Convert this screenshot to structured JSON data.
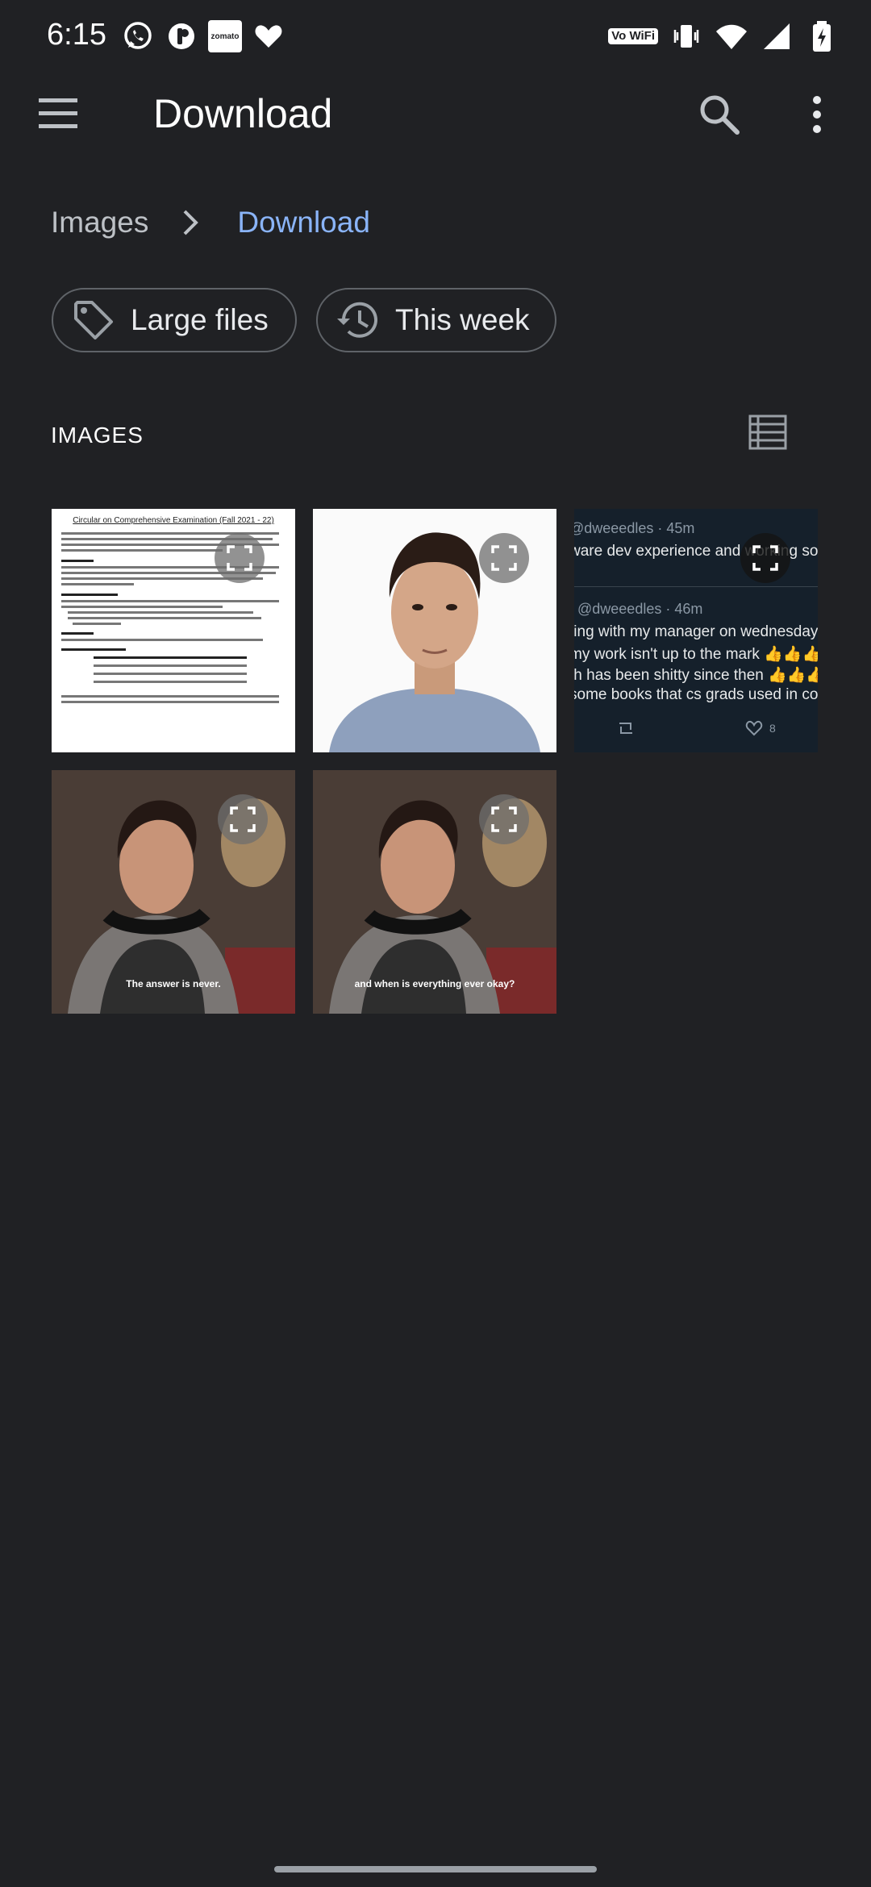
{
  "status_bar": {
    "time": "6:15",
    "left_icons": [
      "whatsapp-icon",
      "pocket-icon",
      "zomato-icon",
      "heart-icon"
    ],
    "zomato_text": "zomato",
    "wifi_calling": "Vo WiFi",
    "right_icons": [
      "vowifi-icon",
      "vibrate-icon",
      "wifi-icon",
      "signal-icon",
      "battery-charging-icon"
    ]
  },
  "app_bar": {
    "title": "Download",
    "menu_icon": "menu-icon",
    "search_icon": "search-icon",
    "more_icon": "more-vert-icon"
  },
  "breadcrumb": {
    "items": [
      "Images",
      "Download"
    ]
  },
  "chips": [
    {
      "label": "Large files",
      "icon": "tag-icon"
    },
    {
      "label": "This week",
      "icon": "history-icon"
    }
  ],
  "section": {
    "label": "IMAGES",
    "view_toggle_icon": "list-view-icon"
  },
  "images": [
    {
      "kind": "document",
      "doc_title": "Circular on Comprehensive Examination (Fall 2021 - 22)"
    },
    {
      "kind": "photo"
    },
    {
      "kind": "tweet",
      "tweet": {
        "handle1": "@dweeedles · 45m",
        "line1": "ware dev experience and working softw",
        "handle2": "@dweeedles · 46m",
        "line2": "ting with my manager on wednesday an",
        "line3": "my work isn't up to the mark 👍👍👍 c",
        "line4": "th has been shitty since then 👍👍👍 h",
        "line5": "some books that cs grads used in college",
        "likes": "8"
      }
    },
    {
      "kind": "video-still",
      "subtitle": "The answer is never."
    },
    {
      "kind": "video-still",
      "subtitle": "and when is everything ever okay?"
    }
  ]
}
